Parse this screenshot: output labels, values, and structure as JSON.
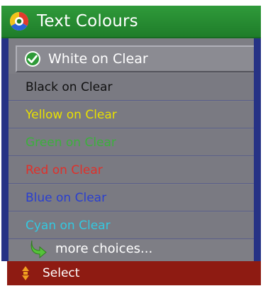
{
  "header": {
    "title": "Text Colours",
    "icon": "colour-wheel-icon"
  },
  "options": [
    {
      "label": "White on Clear",
      "color": "#ffffff",
      "selected": true
    },
    {
      "label": "Black on Clear",
      "color": "#111111",
      "selected": false
    },
    {
      "label": "Yellow on Clear",
      "color": "#e8e000",
      "selected": false
    },
    {
      "label": "Green on Clear",
      "color": "#3cb03c",
      "selected": false
    },
    {
      "label": "Red on Clear",
      "color": "#e0302a",
      "selected": false
    },
    {
      "label": "Blue on Clear",
      "color": "#2a3fd0",
      "selected": false
    },
    {
      "label": "Cyan on Clear",
      "color": "#33c8e0",
      "selected": false
    }
  ],
  "more": {
    "label": "more choices...",
    "icon": "green-arrow-icon"
  },
  "footer": {
    "label": "Select",
    "icon": "up-down-icon"
  },
  "colors": {
    "header_green": "#2f9a3a",
    "frame_blue": "#263285",
    "list_grey": "#7a7a82",
    "footer_red": "#8e1b12"
  }
}
